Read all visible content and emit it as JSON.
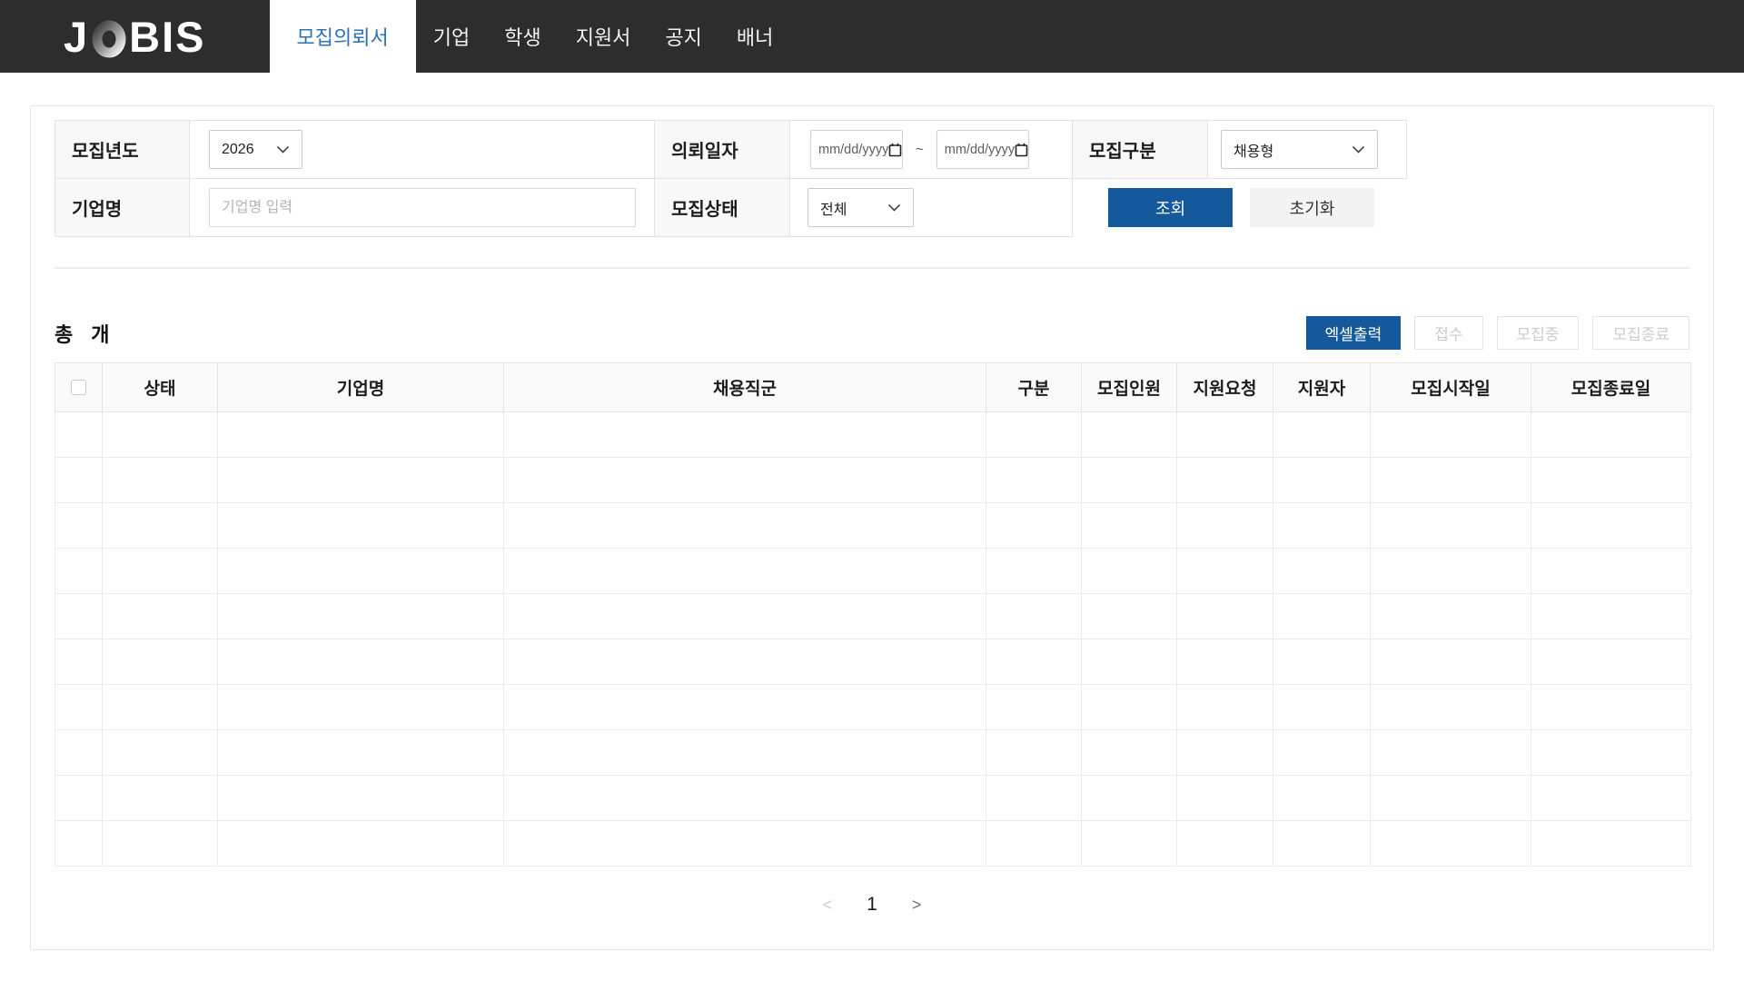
{
  "colors": {
    "navbar_bg": "#2d2d2d",
    "brand_nav_blue": "#2e72b5",
    "button_blue": "#15599d",
    "disabled_text": "#cccccc",
    "label_cell_bg": "#f8f8f8"
  },
  "nav": {
    "logo": "JOBIS",
    "active_item": "모집의뢰서",
    "items": [
      "기업",
      "학생",
      "지원서",
      "공지",
      "배너"
    ]
  },
  "filter": {
    "year_label": "모집년도",
    "year_value": "2026",
    "date_label": "의뢰일자",
    "date_from": "mm/dd/yyyy",
    "date_separator": "~",
    "date_to": "mm/dd/yyyy",
    "type_label": "모집구분",
    "type_value": "채용형",
    "company_label": "기업명",
    "company_placeholder": "기업명 입력",
    "status_label": "모집상태",
    "status_value": "전체",
    "search_button": "조회",
    "reset_button": "초기화"
  },
  "list": {
    "total_prefix": "총",
    "total_count": "",
    "total_suffix": "개",
    "excel_button": "엑셀출력",
    "receive_button": "접수",
    "recruiting_button": "모집중",
    "closed_button": "모집종료",
    "columns": [
      "상태",
      "기업명",
      "채용직군",
      "구분",
      "모집인원",
      "지원요청",
      "지원자",
      "모집시작일",
      "모집종료일"
    ],
    "empty_rows": 10
  },
  "pagination": {
    "prev": "<",
    "current": "1",
    "next": ">"
  }
}
